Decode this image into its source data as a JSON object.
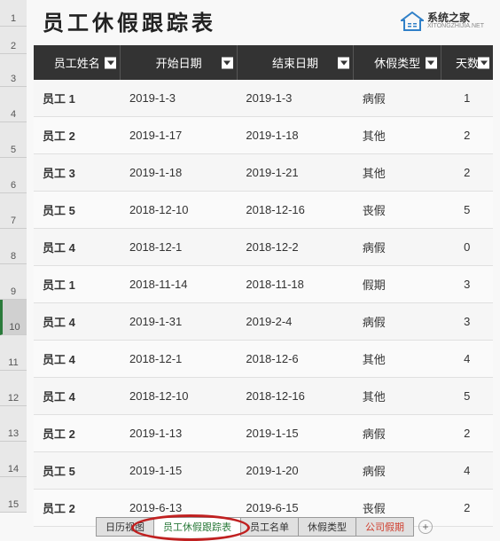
{
  "title": "员工休假跟踪表",
  "logo": {
    "cn": "系统之家",
    "en": "XITONGZHIJIA.NET"
  },
  "row_headers": [
    "1",
    "2",
    "3",
    "4",
    "5",
    "6",
    "7",
    "8",
    "9",
    "10",
    "11",
    "12",
    "13",
    "14",
    "15"
  ],
  "selected_row": "10",
  "columns": [
    "员工姓名",
    "开始日期",
    "结束日期",
    "休假类型",
    "天数"
  ],
  "rows": [
    {
      "name": "员工 1",
      "start": "2019-1-3",
      "end": "2019-1-3",
      "type": "病假",
      "days": "1"
    },
    {
      "name": "员工 2",
      "start": "2019-1-17",
      "end": "2019-1-18",
      "type": "其他",
      "days": "2"
    },
    {
      "name": "员工 3",
      "start": "2019-1-18",
      "end": "2019-1-21",
      "type": "其他",
      "days": "2"
    },
    {
      "name": "员工 5",
      "start": "2018-12-10",
      "end": "2018-12-16",
      "type": "丧假",
      "days": "5"
    },
    {
      "name": "员工 4",
      "start": "2018-12-1",
      "end": "2018-12-2",
      "type": "病假",
      "days": "0"
    },
    {
      "name": "员工 1",
      "start": "2018-11-14",
      "end": "2018-11-18",
      "type": "假期",
      "days": "3"
    },
    {
      "name": "员工 4",
      "start": "2019-1-31",
      "end": "2019-2-4",
      "type": "病假",
      "days": "3"
    },
    {
      "name": "员工 4",
      "start": "2018-12-1",
      "end": "2018-12-6",
      "type": "其他",
      "days": "4"
    },
    {
      "name": "员工 4",
      "start": "2018-12-10",
      "end": "2018-12-16",
      "type": "其他",
      "days": "5"
    },
    {
      "name": "员工 2",
      "start": "2019-1-13",
      "end": "2019-1-15",
      "type": "病假",
      "days": "2"
    },
    {
      "name": "员工 5",
      "start": "2019-1-15",
      "end": "2019-1-20",
      "type": "病假",
      "days": "4"
    },
    {
      "name": "员工 2",
      "start": "2019-6-13",
      "end": "2019-6-15",
      "type": "丧假",
      "days": "2"
    }
  ],
  "tabs": [
    {
      "label": "日历视图",
      "active": false
    },
    {
      "label": "员工休假跟踪表",
      "active": true
    },
    {
      "label": "员工名单",
      "active": false
    },
    {
      "label": "休假类型",
      "active": false
    },
    {
      "label": "公司假期",
      "active": false,
      "holiday": true
    }
  ],
  "add_tab": "+"
}
